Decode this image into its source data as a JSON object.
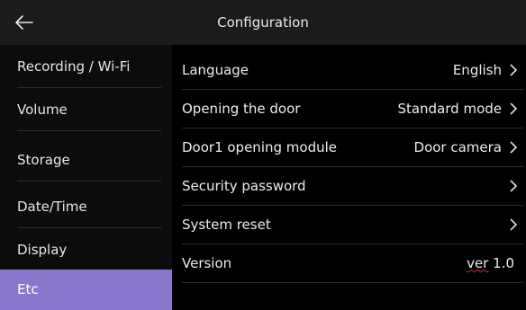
{
  "header": {
    "title": "Configuration",
    "back_icon": "arrow-left-icon"
  },
  "sidebar": {
    "active_color": "#8a78cf",
    "items": [
      {
        "label": "Recording / Wi-Fi"
      },
      {
        "label": "Volume"
      },
      {
        "label": "Storage"
      },
      {
        "label": "Date/Time"
      },
      {
        "label": "Display"
      },
      {
        "label": "Etc",
        "active": true
      }
    ]
  },
  "settings": {
    "language": {
      "label": "Language",
      "value": "English"
    },
    "opening_door": {
      "label": "Opening the door",
      "value": "Standard mode"
    },
    "door1_module": {
      "label": "Door1 opening module",
      "value": "Door camera"
    },
    "security_password": {
      "label": "Security password",
      "value": ""
    },
    "system_reset": {
      "label": "System reset",
      "value": ""
    },
    "version": {
      "label": "Version",
      "prefix": "ver",
      "number": "1.0"
    }
  },
  "icons": {
    "chevron": "chevron-right-icon"
  }
}
